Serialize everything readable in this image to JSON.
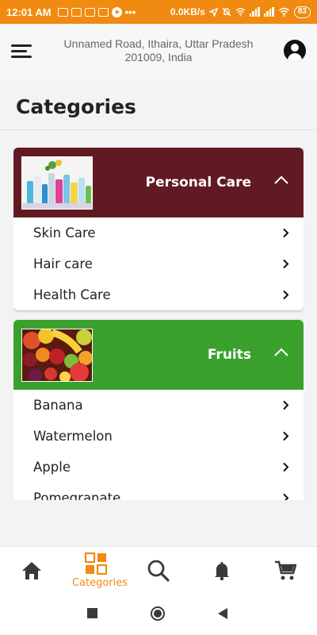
{
  "status_bar": {
    "time": "12:01 AM",
    "dots": "•••",
    "net_speed": "0.0KB/s",
    "battery": "83"
  },
  "header": {
    "address_line1": "Unnamed Road, Ithaira, Uttar Pradesh",
    "address_line2": "201009, India",
    "menu_icon": "hamburger-menu-icon",
    "profile_icon": "account-circle-icon"
  },
  "page": {
    "title": "Categories"
  },
  "categories": [
    {
      "name": "Personal Care",
      "header_color": "#621a22",
      "expanded": true,
      "subcategories": [
        "Skin Care",
        "Hair care",
        "Health Care"
      ]
    },
    {
      "name": "Fruits",
      "header_color": "#3aa12c",
      "expanded": true,
      "subcategories": [
        "Banana",
        "Watermelon",
        "Apple",
        "Pomegranate"
      ]
    }
  ],
  "bottom_nav": {
    "active_color": "#f08a10",
    "items": [
      {
        "icon": "home-icon",
        "label": ""
      },
      {
        "icon": "categories-grid-icon",
        "label": "Categories"
      },
      {
        "icon": "search-icon",
        "label": ""
      },
      {
        "icon": "notification-bell-icon",
        "label": ""
      },
      {
        "icon": "shopping-cart-icon",
        "label": ""
      }
    ]
  },
  "colors": {
    "status_bar": "#f08a10",
    "accent": "#f08a10",
    "background": "#f3f3f4"
  }
}
